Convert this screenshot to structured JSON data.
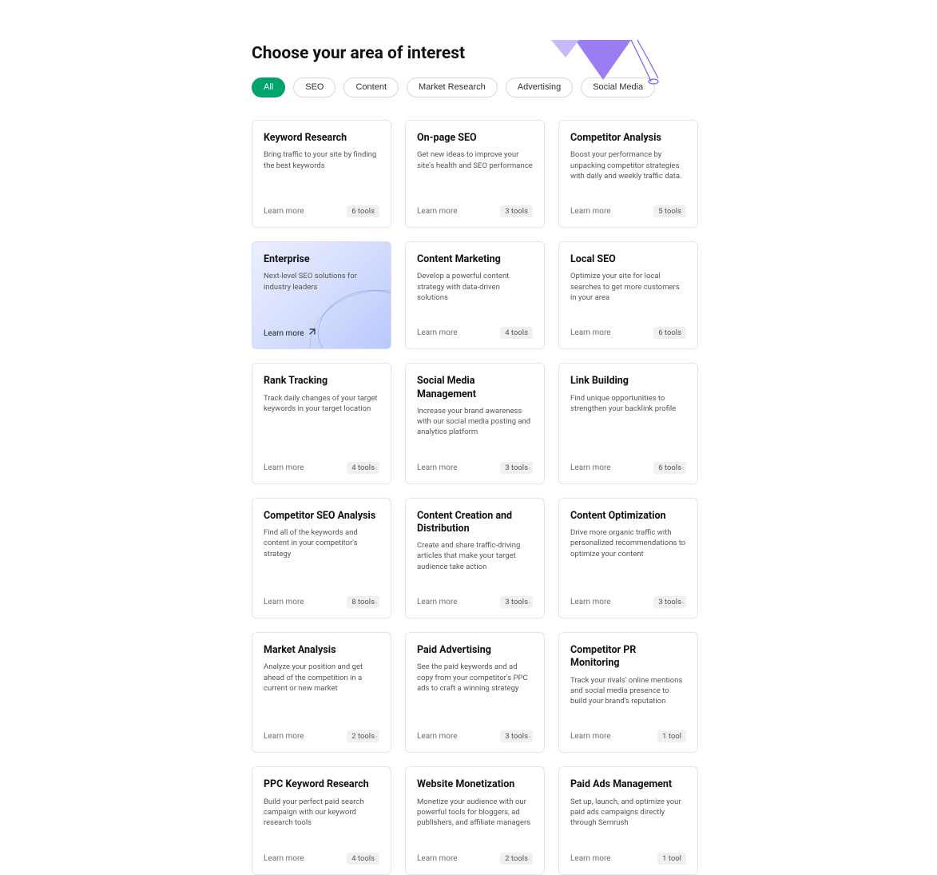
{
  "section_title": "Choose your area of interest",
  "filters": [
    {
      "label": "All",
      "active": true
    },
    {
      "label": "SEO",
      "active": false
    },
    {
      "label": "Content",
      "active": false
    },
    {
      "label": "Market Research",
      "active": false
    },
    {
      "label": "Advertising",
      "active": false
    },
    {
      "label": "Social Media",
      "active": false
    }
  ],
  "learn_more_label": "Learn more",
  "cards": [
    {
      "title": "Keyword Research",
      "desc": "Bring traffic to your site by finding the best keywords",
      "tools": "6 tools",
      "kind": "normal"
    },
    {
      "title": "On-page SEO",
      "desc": "Get new ideas to improve your site's health and SEO performance",
      "tools": "3 tools",
      "kind": "normal"
    },
    {
      "title": "Competitor Analysis",
      "desc": "Boost your performance by unpacking competitor strategies with daily and weekly traffic data.",
      "tools": "5 tools",
      "kind": "normal"
    },
    {
      "title": "Enterprise",
      "desc": "Next-level SEO solutions for industry leaders",
      "tools": "",
      "kind": "enterprise"
    },
    {
      "title": "Content Marketing",
      "desc": "Develop a powerful content strategy with data-driven solutions",
      "tools": "4 tools",
      "kind": "normal"
    },
    {
      "title": "Local SEO",
      "desc": "Optimize your site for local searches to get more customers in your area",
      "tools": "6 tools",
      "kind": "normal"
    },
    {
      "title": "Rank Tracking",
      "desc": "Track daily changes of your target keywords in your target location",
      "tools": "4 tools",
      "kind": "normal"
    },
    {
      "title": "Social Media Management",
      "desc": "Increase your brand awareness with our social media posting and analytics platform",
      "tools": "3 tools",
      "kind": "normal"
    },
    {
      "title": "Link Building",
      "desc": "Find unique opportunities to strengthen your backlink profile",
      "tools": "6 tools",
      "kind": "normal"
    },
    {
      "title": "Competitor SEO Analysis",
      "desc": "Find all of the keywords and content in your competitor's strategy",
      "tools": "8 tools",
      "kind": "normal"
    },
    {
      "title": "Content Creation and Distribution",
      "desc": "Create and share traffic-driving articles that make your target audience take action",
      "tools": "3 tools",
      "kind": "normal"
    },
    {
      "title": "Content Optimization",
      "desc": "Drive more organic traffic with personalized recommendations to optimize your content",
      "tools": "3 tools",
      "kind": "normal"
    },
    {
      "title": "Market Analysis",
      "desc": "Analyze your position and get ahead of the competition in a current or new market",
      "tools": "2 tools",
      "kind": "normal"
    },
    {
      "title": "Paid Advertising",
      "desc": "See the paid keywords and ad copy from your competitor's PPC ads to craft a winning strategy",
      "tools": "3 tools",
      "kind": "normal"
    },
    {
      "title": "Competitor PR Monitoring",
      "desc": "Track your rivals' online mentions and social media presence to build your brand's reputation",
      "tools": "1 tool",
      "kind": "normal"
    },
    {
      "title": "PPC Keyword Research",
      "desc": "Build your perfect paid search campaign with our keyword research tools",
      "tools": "4 tools",
      "kind": "normal"
    },
    {
      "title": "Website Monetization",
      "desc": "Monetize your audience with our powerful tools for bloggers, ad publishers, and affiliate managers",
      "tools": "2 tools",
      "kind": "normal"
    },
    {
      "title": "Paid Ads Management",
      "desc": "Set up, launch, and optimize your paid ads campaigns directly through Semrush",
      "tools": "1 tool",
      "kind": "normal"
    }
  ]
}
